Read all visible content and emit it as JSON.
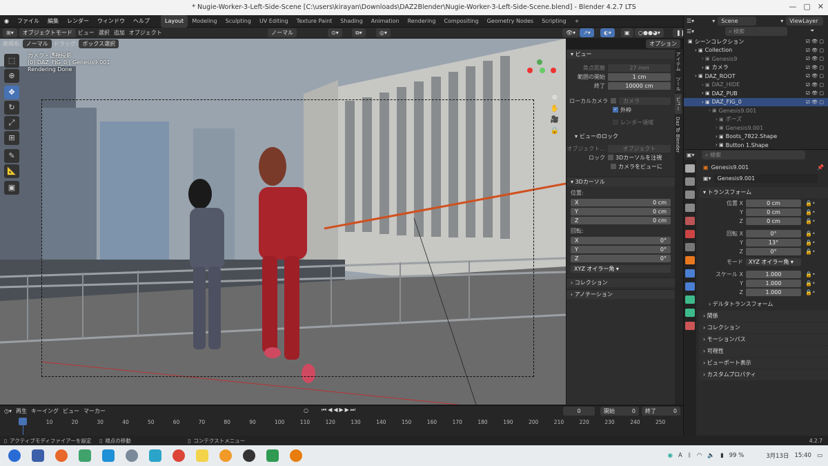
{
  "window": {
    "title": "* Nugie-Worker-3-Left-Side-Scene [C:\\users\\kirayan\\Downloads\\DAZ2Blender\\Nugie-Worker-3-Left-Side-Scene.blend] - Blender 4.2.7 LTS"
  },
  "menu": [
    "ファイル",
    "編集",
    "レンダー",
    "ウィンドウ",
    "ヘルプ"
  ],
  "workspaces": [
    "Layout",
    "Modeling",
    "Sculpting",
    "UV Editing",
    "Texture Paint",
    "Shading",
    "Animation",
    "Rendering",
    "Compositing",
    "Geometry Nodes",
    "Scripting",
    "+"
  ],
  "scene": {
    "label": "Scene",
    "viewlayer": "ViewLayer"
  },
  "vp_header": {
    "mode": "オブジェクトモード",
    "view": "ビュー",
    "select": "選択",
    "add": "追加",
    "object": "オブジェクト",
    "orient": "ノーマル"
  },
  "vp_header2": {
    "coord_label": "座標系:",
    "coord_value": "ノーマル",
    "drag_label": "ドラッグ:",
    "drag_value": "ボックス選択",
    "options": "オプション"
  },
  "overlay_text": {
    "line1": "カメラ・透視投影",
    "line2": "(0) DAZ_FIG_0 | Genesis9.001",
    "line3": "Rendering Done"
  },
  "npanel": {
    "view_header": "ビュー",
    "focal_label": "焦点距離",
    "focal_value": "27 mm",
    "clip_start_label": "範囲の開始",
    "clip_start_value": "1 cm",
    "clip_end_label": "終了",
    "clip_end_value": "10000 cm",
    "local_cam_label": "ローカルカメラ",
    "local_cam_value": "カメラ",
    "outside": "外枠",
    "render_region": "レンダー領域",
    "lock_header": "ビューのロック",
    "lock_obj_label": "オブジェクト...",
    "lock_obj_value": "オブジェクト",
    "lock_label": "ロック",
    "lock_cursor": "3Dカーソルを注視",
    "lock_cam": "カメラをビューに",
    "cursor_header": "3Dカーソル",
    "loc_label": "位置:",
    "x": "X",
    "y": "Y",
    "z": "Z",
    "x_val": "0 cm",
    "y_val": "0 cm",
    "z_val": "0 cm",
    "rot_label": "回転:",
    "rx_val": "0°",
    "ry_val": "0°",
    "rz_val": "0°",
    "rot_mode": "XYZ オイラー角",
    "collection": "コレクション",
    "annotation": "アノテーション"
  },
  "vtabs": [
    "アイテム",
    "ツール",
    "ビュー",
    "Daz To Blender"
  ],
  "timeline": {
    "play_label": "再生",
    "keying": "キーイング",
    "view": "ビュー",
    "marker": "マーカー",
    "current": "0",
    "start_label": "開始",
    "start": "0",
    "end_label": "終了",
    "end": "0",
    "ticks": [
      "0",
      "10",
      "20",
      "30",
      "40",
      "50",
      "60",
      "70",
      "80",
      "90",
      "100",
      "110",
      "120",
      "130",
      "140",
      "150",
      "160",
      "170",
      "180",
      "190",
      "200",
      "210",
      "220",
      "230",
      "240",
      "250"
    ]
  },
  "status": {
    "a": "アクティブモディファイアーを設定",
    "b": "視点の移動",
    "c": "コンテクストメニュー",
    "version": "4.2.7"
  },
  "outliner": {
    "search": "検索",
    "rows": [
      {
        "label": "シーンコレクション",
        "indent": 0,
        "dim": false,
        "sel": false
      },
      {
        "label": "Collection",
        "indent": 1,
        "dim": false,
        "sel": false
      },
      {
        "label": "Genesis9",
        "indent": 2,
        "dim": true,
        "sel": false
      },
      {
        "label": "カメラ",
        "indent": 2,
        "dim": false,
        "sel": false
      },
      {
        "label": "DAZ_ROOT",
        "indent": 1,
        "dim": false,
        "sel": false
      },
      {
        "label": "DAZ_HIDE",
        "indent": 2,
        "dim": true,
        "sel": false
      },
      {
        "label": "DAZ_PUB",
        "indent": 2,
        "dim": false,
        "sel": false
      },
      {
        "label": "DAZ_FIG_0",
        "indent": 2,
        "dim": false,
        "sel": true
      },
      {
        "label": "Genesis9.001",
        "indent": 3,
        "dim": true,
        "sel": false
      },
      {
        "label": "ポーズ",
        "indent": 4,
        "dim": true,
        "sel": false
      },
      {
        "label": "Genesis9.001",
        "indent": 4,
        "dim": true,
        "sel": false
      },
      {
        "label": "Boots_7822.Shape",
        "indent": 4,
        "dim": false,
        "sel": false
      },
      {
        "label": "Button 1.Shape",
        "indent": 4,
        "dim": false,
        "sel": false
      }
    ]
  },
  "properties": {
    "search": "検索",
    "object_name": "Genesis9.001",
    "datablock": "Genesis9.001",
    "transform": "トランスフォーム",
    "loc_label": "位置 X",
    "loc_x": "0 cm",
    "loc_y": "0 cm",
    "loc_z": "0 cm",
    "rot_label": "回転 X",
    "rot_x": "0°",
    "rot_y": "13°",
    "rot_z": "0°",
    "mode_label": "モード",
    "mode_value": "XYZ オイラー角",
    "scale_label": "スケール X",
    "scale_x": "1.000",
    "scale_y": "1.000",
    "scale_z": "1.000",
    "y": "Y",
    "z": "Z",
    "delta": "デルタトランスフォーム",
    "sections": [
      "関係",
      "コレクション",
      "モーションパス",
      "可視性",
      "ビューポート表示",
      "カスタムプロパティ"
    ]
  },
  "taskbar": {
    "lang": "A",
    "battery": "99 %",
    "date": "3月13日",
    "time": "15:40"
  }
}
